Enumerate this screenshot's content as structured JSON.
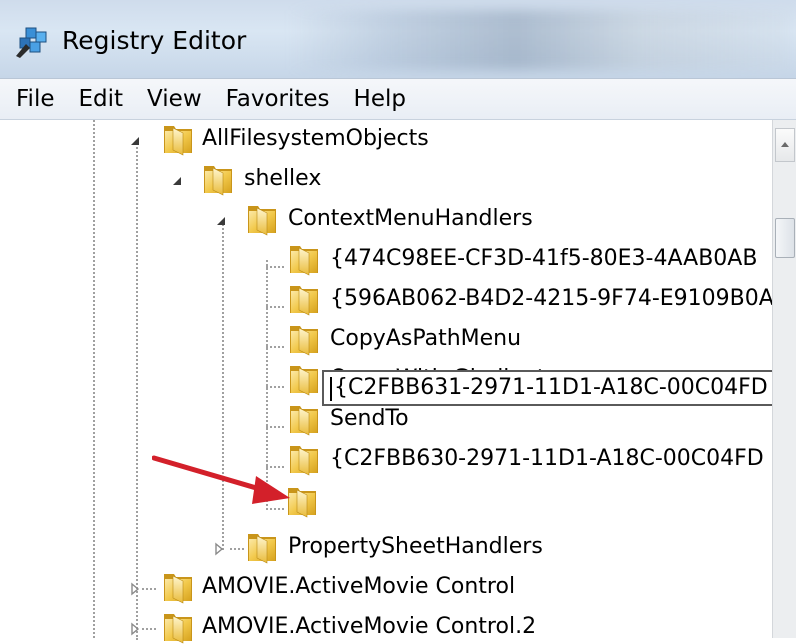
{
  "window": {
    "title": "Registry Editor"
  },
  "menu": [
    "File",
    "Edit",
    "View",
    "Favorites",
    "Help"
  ],
  "tree": {
    "root": "AllFilesystemObjects",
    "shellex": "shellex",
    "context_menu_handlers": "ContextMenuHandlers",
    "handlers": [
      "{474C98EE-CF3D-41f5-80E3-4AAB0AB",
      "{596AB062-B4D2-4215-9F74-E9109B0A",
      "CopyAsPathMenu",
      "Open With Gladinet",
      "SendTo",
      "{C2FBB630-2971-11D1-A18C-00C04FD"
    ],
    "editing_key": "{C2FBB631-2971-11D1-A18C-00C04FD",
    "property_sheet_handlers": "PropertySheetHandlers",
    "siblings": [
      "AMOVIE.ActiveMovie Control",
      "AMOVIE.ActiveMovie Control.2"
    ]
  },
  "colors": {
    "annotation_arrow": "#d3202a",
    "folder_yellow": "#f2c94c"
  }
}
